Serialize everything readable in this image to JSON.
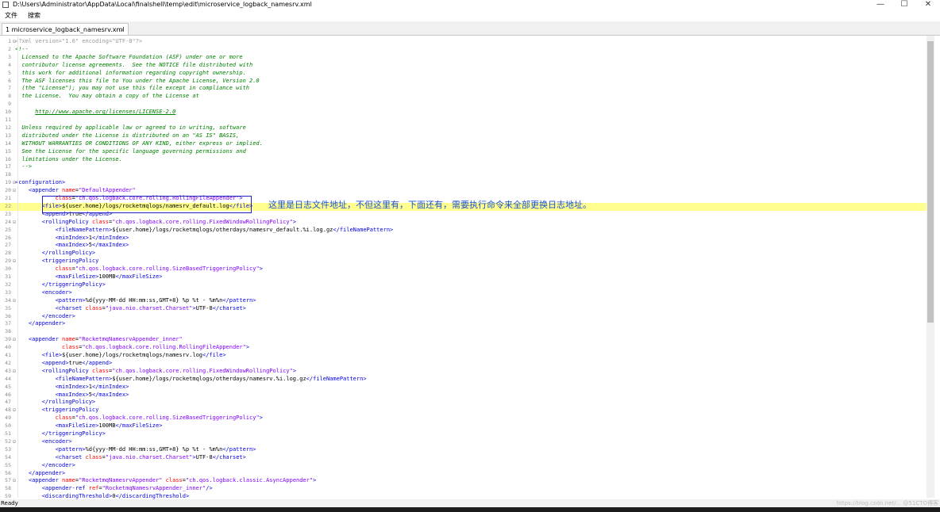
{
  "window": {
    "title": "D:\\Users\\Administrator\\AppData\\Local\\finalshell\\temp\\edit\\microservice_logback_namesrv.xml",
    "minimize": "—",
    "maximize": "☐",
    "close": "✕"
  },
  "menu": {
    "file": "文件",
    "search": "搜索"
  },
  "tab": {
    "label": "1 microservice_logback_namesrv.xml",
    "close": "×"
  },
  "annotation": "这里是日志文件地址，不但这里有，下面还有，需要执行命令来全部更换日志地址。",
  "status": "Ready",
  "watermark": "https://blog.csdn.net/... @51CTO博客",
  "highlighted_line": 22,
  "lines": [
    [
      [
        "pi",
        "<?xml version=\"1.0\" encoding=\"UTF-8\"?>"
      ]
    ],
    [
      [
        "comment",
        "<!--"
      ]
    ],
    [
      [
        "comment",
        "  Licensed to the Apache Software Foundation (ASF) under one or more"
      ]
    ],
    [
      [
        "comment",
        "  contributor license agreements.  See the NOTICE file distributed with"
      ]
    ],
    [
      [
        "comment",
        "  this work for additional information regarding copyright ownership."
      ]
    ],
    [
      [
        "comment",
        "  The ASF licenses this file to You under the Apache License, Version 2.0"
      ]
    ],
    [
      [
        "comment",
        "  (the \"License\"); you may not use this file except in compliance with"
      ]
    ],
    [
      [
        "comment",
        "  the License.  You may obtain a copy of the License at"
      ]
    ],
    [],
    [
      [
        "comment",
        "      "
      ],
      [
        "url",
        "http://www.apache.org/licenses/LICENSE-2.0"
      ]
    ],
    [],
    [
      [
        "comment",
        "  Unless required by applicable law or agreed to in writing, software"
      ]
    ],
    [
      [
        "comment",
        "  distributed under the License is distributed on an \"AS IS\" BASIS,"
      ]
    ],
    [
      [
        "comment",
        "  WITHOUT WARRANTIES OR CONDITIONS OF ANY KIND, either express or implied."
      ]
    ],
    [
      [
        "comment",
        "  See the License for the specific language governing permissions and"
      ]
    ],
    [
      [
        "comment",
        "  limitations under the License."
      ]
    ],
    [
      [
        "comment",
        "  -->"
      ]
    ],
    [],
    [
      [
        "tag",
        "<configuration>"
      ]
    ],
    [
      [
        "text",
        "    "
      ],
      [
        "tag",
        "<appender "
      ],
      [
        "attr",
        "name"
      ],
      [
        "text",
        "="
      ],
      [
        "val",
        "\"DefaultAppender\""
      ]
    ],
    [
      [
        "text",
        "            "
      ],
      [
        "attr",
        "class"
      ],
      [
        "text",
        "="
      ],
      [
        "val",
        "\"ch.qos.logback.core.rolling.RollingFileAppender\""
      ],
      [
        "tag",
        ">"
      ]
    ],
    [
      [
        "text",
        "        "
      ],
      [
        "tag",
        "<file>"
      ],
      [
        "text",
        "${user.home}/logs/rocketmqlogs/namesrv_default.log"
      ],
      [
        "tag",
        "</file>"
      ]
    ],
    [
      [
        "text",
        "        "
      ],
      [
        "tag",
        "<append>"
      ],
      [
        "text",
        "true"
      ],
      [
        "tag",
        "</append>"
      ]
    ],
    [
      [
        "text",
        "        "
      ],
      [
        "tag",
        "<rollingPolicy "
      ],
      [
        "attr",
        "class"
      ],
      [
        "text",
        "="
      ],
      [
        "val",
        "\"ch.qos.logback.core.rolling.FixedWindowRollingPolicy\""
      ],
      [
        "tag",
        ">"
      ]
    ],
    [
      [
        "text",
        "            "
      ],
      [
        "tag",
        "<fileNamePattern>"
      ],
      [
        "text",
        "${user.home}/logs/rocketmqlogs/otherdays/namesrv_default.%i.log.gz"
      ],
      [
        "tag",
        "</fileNamePattern>"
      ]
    ],
    [
      [
        "text",
        "            "
      ],
      [
        "tag",
        "<minIndex>"
      ],
      [
        "text",
        "1"
      ],
      [
        "tag",
        "</minIndex>"
      ]
    ],
    [
      [
        "text",
        "            "
      ],
      [
        "tag",
        "<maxIndex>"
      ],
      [
        "text",
        "5"
      ],
      [
        "tag",
        "</maxIndex>"
      ]
    ],
    [
      [
        "text",
        "        "
      ],
      [
        "tag",
        "</rollingPolicy>"
      ]
    ],
    [
      [
        "text",
        "        "
      ],
      [
        "tag",
        "<triggeringPolicy"
      ]
    ],
    [
      [
        "text",
        "            "
      ],
      [
        "attr",
        "class"
      ],
      [
        "text",
        "="
      ],
      [
        "val",
        "\"ch.qos.logback.core.rolling.SizeBasedTriggeringPolicy\""
      ],
      [
        "tag",
        ">"
      ]
    ],
    [
      [
        "text",
        "            "
      ],
      [
        "tag",
        "<maxFileSize>"
      ],
      [
        "text",
        "100MB"
      ],
      [
        "tag",
        "</maxFileSize>"
      ]
    ],
    [
      [
        "text",
        "        "
      ],
      [
        "tag",
        "</triggeringPolicy>"
      ]
    ],
    [
      [
        "text",
        "        "
      ],
      [
        "tag",
        "<encoder>"
      ]
    ],
    [
      [
        "text",
        "            "
      ],
      [
        "tag",
        "<pattern>"
      ],
      [
        "text",
        "%d{yyy-MM-dd HH:mm:ss,GMT+8} %p %t - %m%n"
      ],
      [
        "tag",
        "</pattern>"
      ]
    ],
    [
      [
        "text",
        "            "
      ],
      [
        "tag",
        "<charset "
      ],
      [
        "attr",
        "class"
      ],
      [
        "text",
        "="
      ],
      [
        "val",
        "\"java.nio.charset.Charset\""
      ],
      [
        "tag",
        ">"
      ],
      [
        "text",
        "UTF-8"
      ],
      [
        "tag",
        "</charset>"
      ]
    ],
    [
      [
        "text",
        "        "
      ],
      [
        "tag",
        "</encoder>"
      ]
    ],
    [
      [
        "text",
        "    "
      ],
      [
        "tag",
        "</appender>"
      ]
    ],
    [],
    [
      [
        "text",
        "    "
      ],
      [
        "tag",
        "<appender "
      ],
      [
        "attr",
        "name"
      ],
      [
        "text",
        "="
      ],
      [
        "val",
        "\"RocketmqNamesrvAppender_inner\""
      ]
    ],
    [
      [
        "text",
        "              "
      ],
      [
        "attr",
        "class"
      ],
      [
        "text",
        "="
      ],
      [
        "val",
        "\"ch.qos.logback.core.rolling.RollingFileAppender\""
      ],
      [
        "tag",
        ">"
      ]
    ],
    [
      [
        "text",
        "        "
      ],
      [
        "tag",
        "<file>"
      ],
      [
        "text",
        "${user.home}/logs/rocketmqlogs/namesrv.log"
      ],
      [
        "tag",
        "</file>"
      ]
    ],
    [
      [
        "text",
        "        "
      ],
      [
        "tag",
        "<append>"
      ],
      [
        "text",
        "true"
      ],
      [
        "tag",
        "</append>"
      ]
    ],
    [
      [
        "text",
        "        "
      ],
      [
        "tag",
        "<rollingPolicy "
      ],
      [
        "attr",
        "class"
      ],
      [
        "text",
        "="
      ],
      [
        "val",
        "\"ch.qos.logback.core.rolling.FixedWindowRollingPolicy\""
      ],
      [
        "tag",
        ">"
      ]
    ],
    [
      [
        "text",
        "            "
      ],
      [
        "tag",
        "<fileNamePattern>"
      ],
      [
        "text",
        "${user.home}/logs/rocketmqlogs/otherdays/namesrv.%i.log.gz"
      ],
      [
        "tag",
        "</fileNamePattern>"
      ]
    ],
    [
      [
        "text",
        "            "
      ],
      [
        "tag",
        "<minIndex>"
      ],
      [
        "text",
        "1"
      ],
      [
        "tag",
        "</minIndex>"
      ]
    ],
    [
      [
        "text",
        "            "
      ],
      [
        "tag",
        "<maxIndex>"
      ],
      [
        "text",
        "5"
      ],
      [
        "tag",
        "</maxIndex>"
      ]
    ],
    [
      [
        "text",
        "        "
      ],
      [
        "tag",
        "</rollingPolicy>"
      ]
    ],
    [
      [
        "text",
        "        "
      ],
      [
        "tag",
        "<triggeringPolicy"
      ]
    ],
    [
      [
        "text",
        "            "
      ],
      [
        "attr",
        "class"
      ],
      [
        "text",
        "="
      ],
      [
        "val",
        "\"ch.qos.logback.core.rolling.SizeBasedTriggeringPolicy\""
      ],
      [
        "tag",
        ">"
      ]
    ],
    [
      [
        "text",
        "            "
      ],
      [
        "tag",
        "<maxFileSize>"
      ],
      [
        "text",
        "100MB"
      ],
      [
        "tag",
        "</maxFileSize>"
      ]
    ],
    [
      [
        "text",
        "        "
      ],
      [
        "tag",
        "</triggeringPolicy>"
      ]
    ],
    [
      [
        "text",
        "        "
      ],
      [
        "tag",
        "<encoder>"
      ]
    ],
    [
      [
        "text",
        "            "
      ],
      [
        "tag",
        "<pattern>"
      ],
      [
        "text",
        "%d{yyy-MM-dd HH:mm:ss,GMT+8} %p %t - %m%n"
      ],
      [
        "tag",
        "</pattern>"
      ]
    ],
    [
      [
        "text",
        "            "
      ],
      [
        "tag",
        "<charset "
      ],
      [
        "attr",
        "class"
      ],
      [
        "text",
        "="
      ],
      [
        "val",
        "\"java.nio.charset.Charset\""
      ],
      [
        "tag",
        ">"
      ],
      [
        "text",
        "UTF-8"
      ],
      [
        "tag",
        "</charset>"
      ]
    ],
    [
      [
        "text",
        "        "
      ],
      [
        "tag",
        "</encoder>"
      ]
    ],
    [
      [
        "text",
        "    "
      ],
      [
        "tag",
        "</appender>"
      ]
    ],
    [
      [
        "text",
        "    "
      ],
      [
        "tag",
        "<appender "
      ],
      [
        "attr",
        "name"
      ],
      [
        "text",
        "="
      ],
      [
        "val",
        "\"RocketmqNamesrvAppender\""
      ],
      [
        "text",
        " "
      ],
      [
        "attr",
        "class"
      ],
      [
        "text",
        "="
      ],
      [
        "val",
        "\"ch.qos.logback.classic.AsyncAppender\""
      ],
      [
        "tag",
        ">"
      ]
    ],
    [
      [
        "text",
        "        "
      ],
      [
        "tag",
        "<appender-ref "
      ],
      [
        "attr",
        "ref"
      ],
      [
        "text",
        "="
      ],
      [
        "val",
        "\"RocketmqNamesrvAppender_inner\""
      ],
      [
        "tag",
        "/>"
      ]
    ],
    [
      [
        "text",
        "        "
      ],
      [
        "tag",
        "<discardingThreshold>"
      ],
      [
        "text",
        "0"
      ],
      [
        "tag",
        "</discardingThreshold>"
      ]
    ]
  ],
  "fold_lines": [
    1,
    19,
    20,
    24,
    29,
    34,
    39,
    43,
    48,
    52,
    57
  ]
}
